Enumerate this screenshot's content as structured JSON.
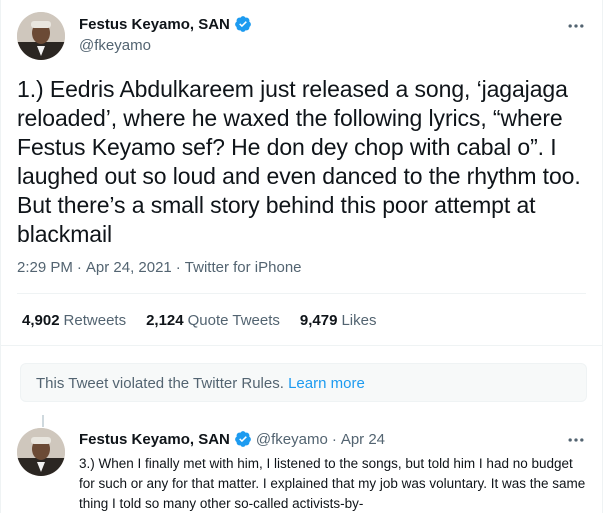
{
  "tweet": {
    "author_name": "Festus Keyamo, SAN",
    "author_handle": "@fkeyamo",
    "text": "1.) Eedris Abdulkareem just released a song, ‘jagajaga reloaded’, where he waxed the following lyrics, “where Festus Keyamo sef? He don dey chop with cabal o”. I laughed out so loud and even danced to the rhythm too. But there’s a small story behind this poor attempt at blackmail",
    "time": "2:29 PM",
    "date": "Apr 24, 2021",
    "source": "Twitter for iPhone",
    "stats": [
      {
        "count": "4,902",
        "label": "Retweets"
      },
      {
        "count": "2,124",
        "label": "Quote Tweets"
      },
      {
        "count": "9,479",
        "label": "Likes"
      }
    ]
  },
  "notice": {
    "text": "This Tweet violated the Twitter Rules.",
    "link": "Learn more"
  },
  "reply": {
    "author_name": "Festus Keyamo, SAN",
    "author_handle": "@fkeyamo",
    "date": "Apr 24",
    "text": "3.) When I finally met with him, I listened to the songs, but told him I had no budget for such or any for that matter. I explained that my job was voluntary. It was the same thing I told so many other so-called activists-by-"
  },
  "colors": {
    "accent": "#1d9bf0",
    "secondary_text": "#536471",
    "primary_text": "#0f1419"
  },
  "icons": [
    "verified-badge-icon",
    "more-options-icon",
    "avatar-photo"
  ]
}
